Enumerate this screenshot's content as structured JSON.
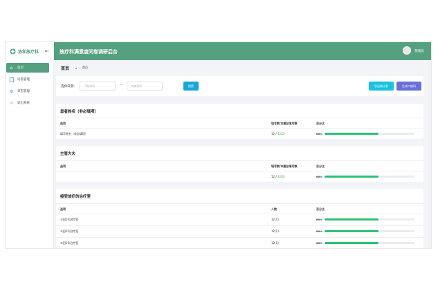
{
  "colors": {
    "primary": "#55a07f",
    "progress": "#2bc071",
    "btn_blue": "#1aa7d8",
    "btn_purple": "#6a6fd8"
  },
  "sidebar": {
    "logo_text": "协和放疗科",
    "items": [
      {
        "label": "首页",
        "icon": "home-icon",
        "active": true
      },
      {
        "label": "问卷管理",
        "icon": "document-icon",
        "active": false
      },
      {
        "label": "日志管理",
        "icon": "gear-icon",
        "active": false
      },
      {
        "label": "退出系统",
        "icon": "exit-icon",
        "active": false
      }
    ]
  },
  "header": {
    "title": "放疗科满意度问卷调研后台",
    "user": "管理员"
  },
  "breadcrumb": {
    "title": "首页",
    "current": "首页"
  },
  "filter": {
    "label": "选择日期：",
    "start_placeholder": "开始时间",
    "sep": "—",
    "end_placeholder": "结束时间",
    "search_button": "搜索",
    "export_button": "导出统计表",
    "qrcode_button": "生成二维码"
  },
  "section1": {
    "title": "患者姓名（非必填项）",
    "headers": [
      "选项",
      "填写数/本题总填写数",
      "百分比"
    ],
    "rows": [
      {
        "option": "填写姓名（非必填项）",
        "count": "12",
        "total": "12(2)",
        "pct_label": "60%",
        "pct": 0.6
      }
    ]
  },
  "section2": {
    "title": "主管大夫",
    "headers": [
      "选项",
      "填写数/本题总填写数",
      "百分比"
    ],
    "rows": [
      {
        "option": "",
        "count": "12",
        "total": "12(2)",
        "pct_label": "60%",
        "pct": 0.6
      }
    ]
  },
  "section3": {
    "title": "接受放疗的治疗室",
    "headers": [
      "选项",
      "人数",
      "百分比"
    ],
    "rows": [
      {
        "option": "①回2号治疗室",
        "count": "12(1)",
        "pct_label": "60%",
        "pct": 0.6
      },
      {
        "option": "②回2号治疗室",
        "count": "12(1)",
        "pct_label": "60%",
        "pct": 0.6
      },
      {
        "option": "③回2号治疗室",
        "count": "12(1)",
        "pct_label": "60%",
        "pct": 0.6
      }
    ]
  }
}
